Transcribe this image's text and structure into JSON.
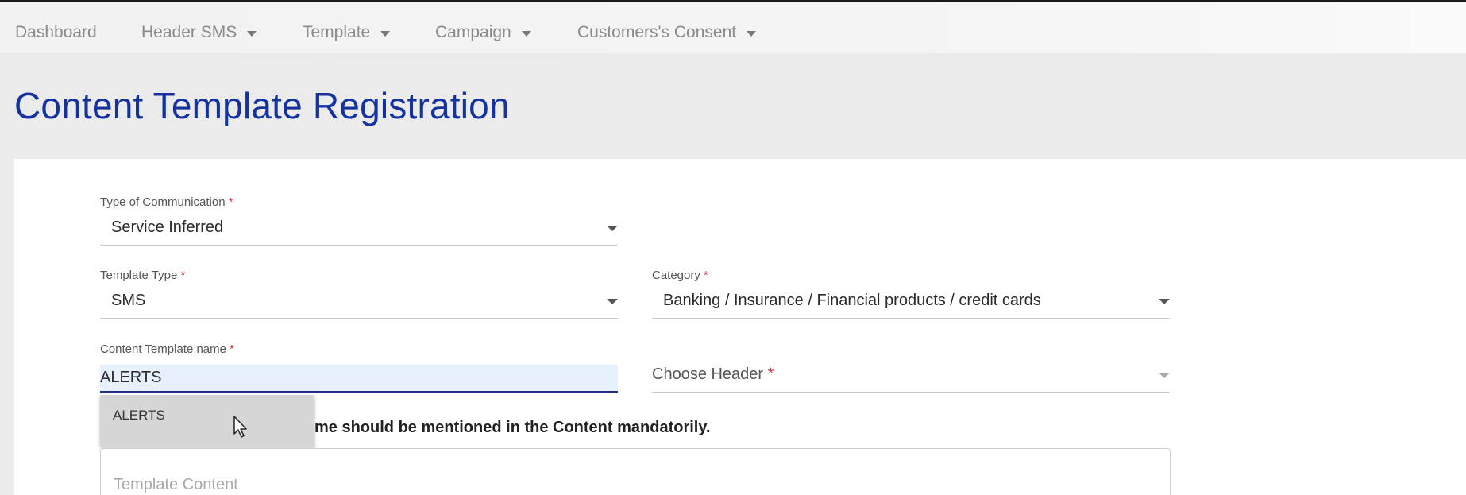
{
  "nav": {
    "items": [
      {
        "label": "Dashboard",
        "has_dropdown": false
      },
      {
        "label": "Header SMS",
        "has_dropdown": true
      },
      {
        "label": "Template",
        "has_dropdown": true
      },
      {
        "label": "Campaign",
        "has_dropdown": true
      },
      {
        "label": "Customers's Consent",
        "has_dropdown": true
      }
    ]
  },
  "page": {
    "title": "Content Template Registration"
  },
  "form": {
    "type_of_communication": {
      "label": "Type of Communication",
      "required_mark": "*",
      "value": "Service Inferred"
    },
    "template_type": {
      "label": "Template Type",
      "required_mark": "*",
      "value": "SMS"
    },
    "category": {
      "label": "Category",
      "required_mark": "*",
      "value": "Banking / Insurance / Financial products / credit cards"
    },
    "content_template_name": {
      "label": "Content Template name",
      "required_mark": "*",
      "value": "ALERTS"
    },
    "choose_header": {
      "placeholder": "Choose Header",
      "required_mark": "*"
    },
    "notice_visible_text": "me should be mentioned in the Content mandatorily.",
    "template_content": {
      "placeholder": "Template Content"
    }
  },
  "autocomplete": {
    "options": [
      "ALERTS"
    ]
  },
  "colors": {
    "title": "#1432a0",
    "required": "#d23a3a",
    "input_focus_bg": "#e8f0fe",
    "input_focus_border": "#1d2f8a"
  },
  "icons": [
    "caret-down-icon",
    "mouse-pointer-icon"
  ]
}
